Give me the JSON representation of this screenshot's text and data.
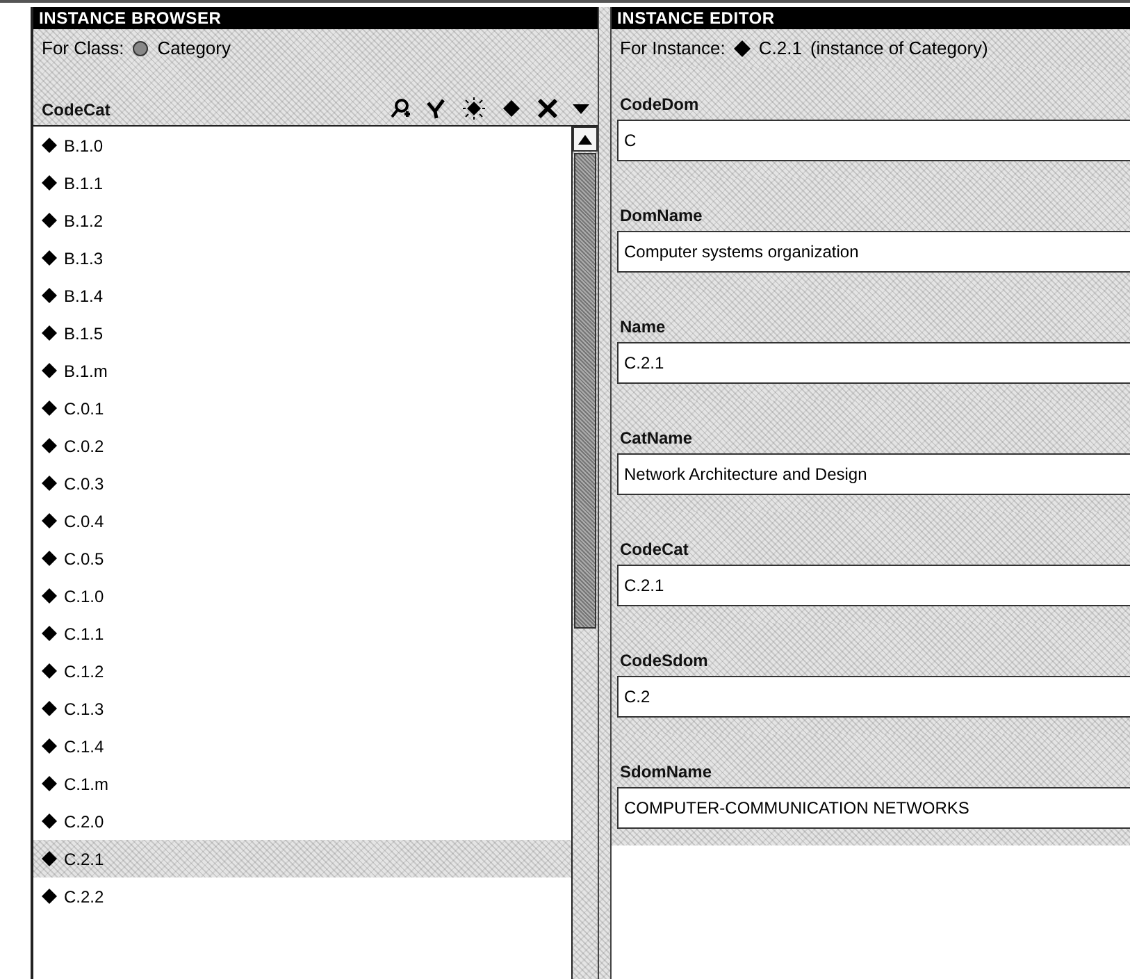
{
  "browser": {
    "title": "INSTANCE BROWSER",
    "class_label": "For Class:",
    "class_name": "Category",
    "list_header": "CodeCat",
    "items": [
      {
        "label": "B.1.0",
        "selected": false
      },
      {
        "label": "B.1.1",
        "selected": false
      },
      {
        "label": "B.1.2",
        "selected": false
      },
      {
        "label": "B.1.3",
        "selected": false
      },
      {
        "label": "B.1.4",
        "selected": false
      },
      {
        "label": "B.1.5",
        "selected": false
      },
      {
        "label": "B.1.m",
        "selected": false
      },
      {
        "label": "C.0.1",
        "selected": false
      },
      {
        "label": "C.0.2",
        "selected": false
      },
      {
        "label": "C.0.3",
        "selected": false
      },
      {
        "label": "C.0.4",
        "selected": false
      },
      {
        "label": "C.0.5",
        "selected": false
      },
      {
        "label": "C.1.0",
        "selected": false
      },
      {
        "label": "C.1.1",
        "selected": false
      },
      {
        "label": "C.1.2",
        "selected": false
      },
      {
        "label": "C.1.3",
        "selected": false
      },
      {
        "label": "C.1.4",
        "selected": false
      },
      {
        "label": "C.1.m",
        "selected": false
      },
      {
        "label": "C.2.0",
        "selected": false
      },
      {
        "label": "C.2.1",
        "selected": true
      },
      {
        "label": "C.2.2",
        "selected": false
      }
    ]
  },
  "editor": {
    "title": "INSTANCE EDITOR",
    "instance_label": "For Instance:",
    "instance_name": "C.2.1",
    "instance_of": "(instance of Category)",
    "fields": [
      {
        "label": "CodeDom",
        "value": "C"
      },
      {
        "label": "DomName",
        "value": "Computer systems organization"
      },
      {
        "label": "Name",
        "value": "C.2.1"
      },
      {
        "label": "CatName",
        "value": "Network Architecture and Design"
      },
      {
        "label": "CodeCat",
        "value": "C.2.1"
      },
      {
        "label": "CodeSdom",
        "value": "C.2"
      },
      {
        "label": "SdomName",
        "value": "COMPUTER-COMMUNICATION NETWORKS"
      }
    ]
  }
}
